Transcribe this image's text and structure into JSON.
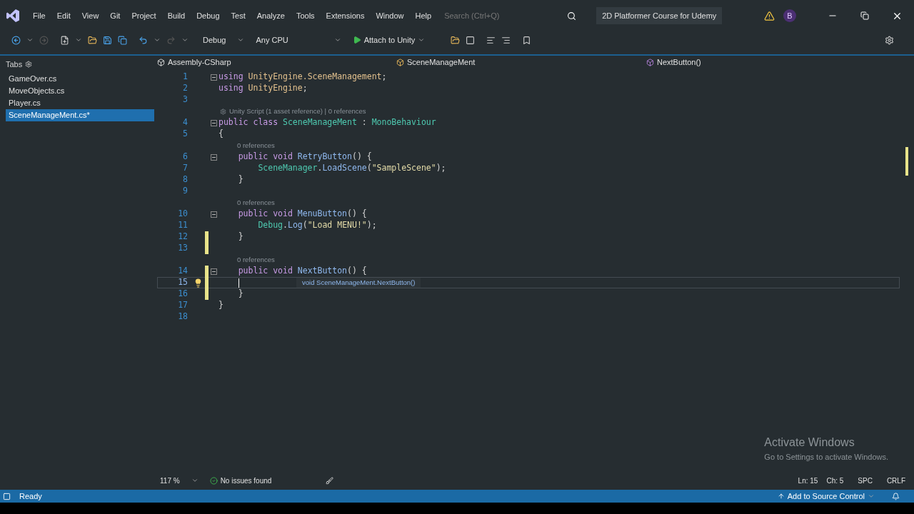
{
  "menu": [
    "File",
    "Edit",
    "View",
    "Git",
    "Project",
    "Build",
    "Debug",
    "Test",
    "Analyze",
    "Tools",
    "Extensions",
    "Window",
    "Help"
  ],
  "search": {
    "placeholder": "Search (Ctrl+Q)"
  },
  "solution_title": "2D Platformer Course for Udemy",
  "account_initial": "B",
  "toolbar": {
    "configuration": "Debug",
    "platform": "Any CPU",
    "run": "Attach to Unity"
  },
  "tabs_panel": {
    "title": "Tabs",
    "items": [
      {
        "label": "GameOver.cs",
        "selected": false
      },
      {
        "label": "MoveObjects.cs",
        "selected": false
      },
      {
        "label": "Player.cs",
        "selected": false
      },
      {
        "label": "SceneManageMent.cs*",
        "selected": true
      }
    ]
  },
  "nav_bar": {
    "project": "Assembly-CSharp",
    "class": "SceneManageMent",
    "member": "NextButton()"
  },
  "code_lines": [
    {
      "number": "1",
      "fold": true,
      "tokens": [
        {
          "text": "using ",
          "kind": "keyword"
        },
        {
          "text": "UnityEngine.SceneManagement",
          "kind": "namespace"
        },
        {
          "text": ";",
          "kind": "punctuation"
        }
      ]
    },
    {
      "number": "2",
      "tokens": [
        {
          "text": "using ",
          "kind": "keyword"
        },
        {
          "text": "UnityEngine",
          "kind": "namespace"
        },
        {
          "text": ";",
          "kind": "punctuation"
        }
      ]
    },
    {
      "number": "3"
    },
    {
      "number": "4",
      "fold": true,
      "lens": "Unity Script (1 asset reference) | 0 references",
      "lens_icon": true,
      "tokens": [
        {
          "text": "public class ",
          "kind": "keyword"
        },
        {
          "text": "SceneManageMent",
          "kind": "type"
        },
        {
          "text": " : ",
          "kind": "punctuation"
        },
        {
          "text": "MonoBehaviour",
          "kind": "type"
        }
      ]
    },
    {
      "number": "5",
      "tokens": [
        {
          "text": "{",
          "kind": "punctuation"
        }
      ]
    },
    {
      "number": "6",
      "fold": true,
      "lens": "0 references",
      "tokens": [
        {
          "text": "    public void ",
          "kind": "keyword"
        },
        {
          "text": "RetryButton",
          "kind": "method"
        },
        {
          "text": "() {",
          "kind": "punctuation"
        }
      ]
    },
    {
      "number": "7",
      "tokens": [
        {
          "text": "        SceneManager",
          "kind": "type"
        },
        {
          "text": ".",
          "kind": "punctuation"
        },
        {
          "text": "LoadScene",
          "kind": "method"
        },
        {
          "text": "(",
          "kind": "punctuation"
        },
        {
          "text": "\"SampleScene\"",
          "kind": "string"
        },
        {
          "text": ");",
          "kind": "punctuation"
        }
      ]
    },
    {
      "number": "8",
      "tokens": [
        {
          "text": "    }",
          "kind": "punctuation"
        }
      ]
    },
    {
      "number": "9"
    },
    {
      "number": "10",
      "fold": true,
      "lens": "0 references",
      "tokens": [
        {
          "text": "    public void ",
          "kind": "keyword"
        },
        {
          "text": "MenuButton",
          "kind": "method"
        },
        {
          "text": "() {",
          "kind": "punctuation"
        }
      ]
    },
    {
      "number": "11",
      "tokens": [
        {
          "text": "        Debug",
          "kind": "type"
        },
        {
          "text": ".",
          "kind": "punctuation"
        },
        {
          "text": "Log",
          "kind": "method"
        },
        {
          "text": "(",
          "kind": "punctuation"
        },
        {
          "text": "\"Load MENU!\"",
          "kind": "string"
        },
        {
          "text": ");",
          "kind": "punctuation"
        }
      ]
    },
    {
      "number": "12",
      "modified": true,
      "tokens": [
        {
          "text": "    }",
          "kind": "punctuation"
        }
      ]
    },
    {
      "number": "13",
      "modified": true
    },
    {
      "number": "14",
      "fold": true,
      "modified": true,
      "lens": "0 references",
      "tokens": [
        {
          "text": "    public void ",
          "kind": "keyword"
        },
        {
          "text": "NextButton",
          "kind": "method"
        },
        {
          "text": "() {",
          "kind": "punctuation"
        }
      ]
    },
    {
      "number": "15",
      "modified": true,
      "current": true,
      "lightbulb": true,
      "tooltip": "void SceneManageMent.NextButton()"
    },
    {
      "number": "16",
      "modified": true,
      "tokens": [
        {
          "text": "    }",
          "kind": "punctuation"
        }
      ]
    },
    {
      "number": "17",
      "tokens": [
        {
          "text": "}",
          "kind": "punctuation"
        }
      ]
    },
    {
      "number": "18"
    }
  ],
  "editor_footer": {
    "zoom": "117 %",
    "issues": "No issues found",
    "line": "Ln: 15",
    "column": "Ch: 5",
    "whitespace": "SPC",
    "line_ending": "CRLF"
  },
  "activation_notice": {
    "title": "Activate Windows",
    "message": "Go to Settings to activate Windows."
  },
  "status_bar": {
    "state": "Ready",
    "source_control": "Add to Source Control"
  }
}
